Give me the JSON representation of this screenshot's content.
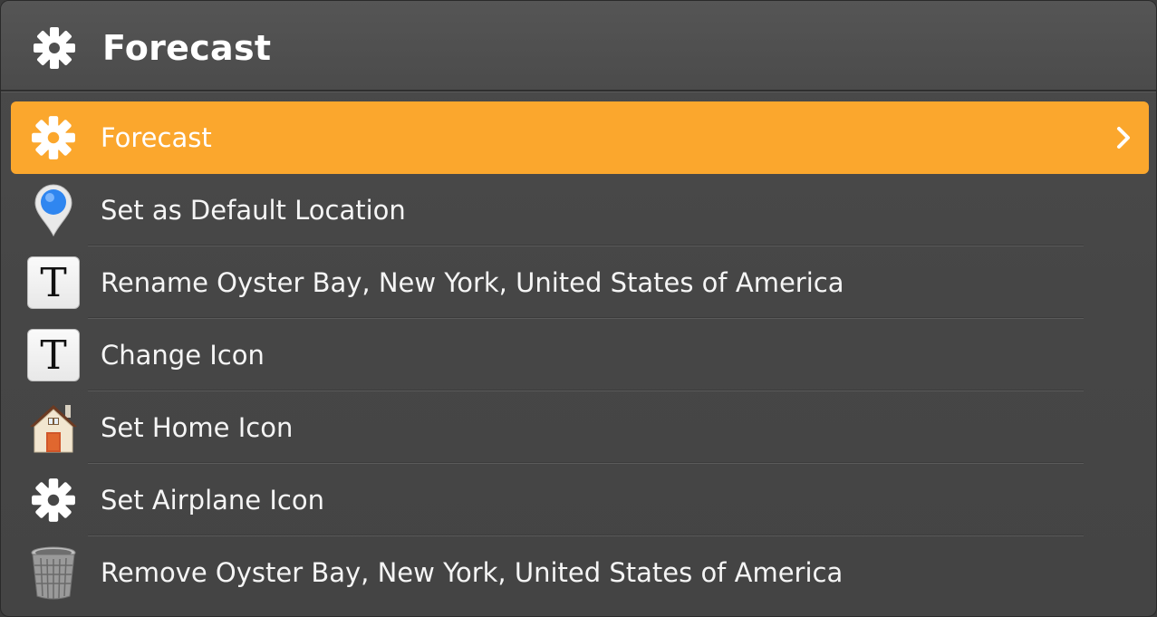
{
  "header": {
    "title": "Forecast",
    "icon": "gear-icon"
  },
  "menu": {
    "selected": {
      "label": "Forecast",
      "icon": "gear-icon",
      "accent": "#fba72d"
    },
    "items": [
      {
        "label": "Set as Default Location",
        "icon": "map-pin-icon"
      },
      {
        "label": "Rename Oyster Bay, New York, United States of America",
        "icon": "text-t-icon",
        "glyph": "T"
      },
      {
        "label": "Change Icon",
        "icon": "text-t-icon",
        "glyph": "T"
      },
      {
        "label": "Set Home Icon",
        "icon": "house-icon"
      },
      {
        "label": "Set Airplane Icon",
        "icon": "gear-icon"
      },
      {
        "label": "Remove Oyster Bay, New York, United States of America",
        "icon": "trash-can-icon"
      }
    ]
  }
}
